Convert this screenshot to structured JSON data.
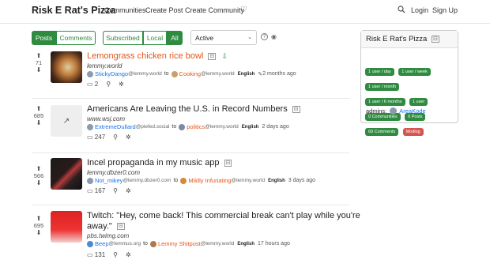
{
  "nav": {
    "brand": "Risk E Rat's Pizza",
    "links": [
      "Communities",
      "Create Post",
      "Create Community"
    ],
    "login": "Login",
    "signup": "Sign Up"
  },
  "filters": {
    "type": [
      "Posts",
      "Comments"
    ],
    "listing": [
      "Subscribed",
      "Local",
      "All"
    ],
    "sort": "Active"
  },
  "posts": [
    {
      "score": "71",
      "title": "Lemongrass chicken rice bowl",
      "domain": "lemmy.world",
      "user": "StickyDango",
      "user_inst": "@lemmy.world",
      "to": "to",
      "community": "Cooking",
      "comm_inst": "@lemmy.world",
      "lang": "English",
      "time": "2 months ago",
      "comments": "2"
    },
    {
      "score": "685",
      "title": "Americans Are Leaving the U.S. in Record Numbers",
      "domain": "www.wsj.com",
      "user": "ExtremeDullard",
      "user_inst": "@piefed.social",
      "to": "to",
      "community": "politics",
      "comm_inst": "@lemmy.world",
      "lang": "English",
      "time": "2 days ago",
      "comments": "247"
    },
    {
      "score": "566",
      "title": "Incel propaganda in my music app",
      "domain": "lemmy.dbzer0.com",
      "user": "Not_mikey",
      "user_inst": "@lemmy.dbzer0.com",
      "to": "to",
      "community": "Mildly Infuriating",
      "comm_inst": "@lemmy.world",
      "lang": "English",
      "time": "3 days ago",
      "comments": "167"
    },
    {
      "score": "695",
      "title": "Twitch: \"Hey, come back! This commercial break can't play while you're",
      "title2": "away.\"",
      "domain": "pbs.twimg.com",
      "user": "Beep",
      "user_inst": "@lemmus.org",
      "to": "to",
      "community": "Lemmy Shitpost",
      "comm_inst": "@lemmy.world",
      "lang": "English",
      "time": "17 hours ago",
      "comments": "131"
    }
  ],
  "sidebar": {
    "title": "Risk E Rat's Pizza",
    "badges": [
      "1 user / day",
      "1 user / week",
      "1 user / month",
      "1 user / 6 months",
      "1 user",
      "0 Communities",
      "0 Posts",
      "69 Comments",
      "Modlog"
    ],
    "admins_label": "admins:",
    "admin": "AreaKode"
  },
  "colors": {
    "accent": "#2e8b3f",
    "title_orange": "#e2561b",
    "link_blue": "#1a73e8",
    "modlog_red": "#d9534f"
  }
}
